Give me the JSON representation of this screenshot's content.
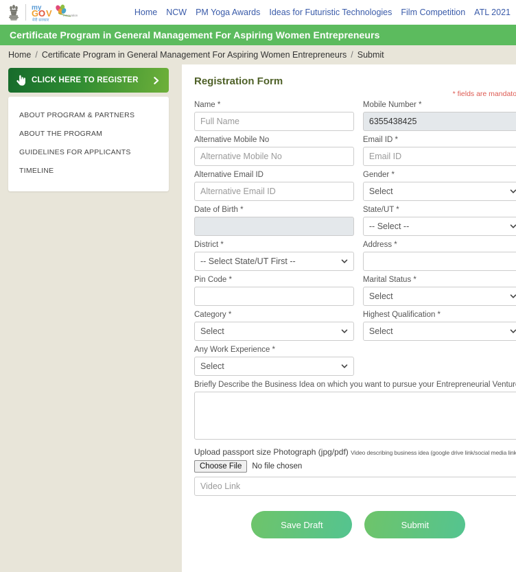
{
  "topnav": {
    "logo_alt": "myGov",
    "links": [
      {
        "label": "Home"
      },
      {
        "label": "NCW"
      },
      {
        "label": "PM Yoga Awards"
      },
      {
        "label": "Ideas for Futuristic Technologies"
      },
      {
        "label": "Film Competition"
      },
      {
        "label": "ATL 2021"
      }
    ]
  },
  "banner": {
    "title": "Certificate Program in General Management For Aspiring Women Entrepreneurs",
    "color": "#5cbb5e"
  },
  "breadcrumb": {
    "items": [
      {
        "label": "Home"
      },
      {
        "label": "Certificate Program in General Management For Aspiring Women Entrepreneurs"
      },
      {
        "label": "Submit"
      }
    ],
    "separator": "/"
  },
  "sidebar": {
    "register_button": {
      "label": "CLICK HERE TO REGISTER"
    },
    "items": [
      {
        "label": "ABOUT PROGRAM & PARTNERS"
      },
      {
        "label": "ABOUT THE PROGRAM"
      },
      {
        "label": "GUIDELINES FOR APPLICANTS"
      },
      {
        "label": "TIMELINE"
      }
    ]
  },
  "form": {
    "title": "Registration Form",
    "title_color": "#4f6128",
    "mandatory_note": "* fields are mandatory",
    "mandatory_color": "#dd5a52",
    "fields": {
      "name": {
        "label": "Name *",
        "placeholder": "Full Name",
        "value": ""
      },
      "mobile": {
        "label": "Mobile Number *",
        "placeholder": "",
        "value": "6355438425"
      },
      "alt_mobile": {
        "label": "Alternative Mobile No",
        "placeholder": "Alternative Mobile No",
        "value": ""
      },
      "email": {
        "label": "Email ID *",
        "placeholder": "Email ID",
        "value": ""
      },
      "alt_email": {
        "label": "Alternative Email ID",
        "placeholder": "Alternative Email ID",
        "value": ""
      },
      "gender": {
        "label": "Gender *",
        "selected": "Select"
      },
      "dob": {
        "label": "Date of Birth *",
        "placeholder": "",
        "value": ""
      },
      "state": {
        "label": "State/UT *",
        "selected": "-- Select --"
      },
      "district": {
        "label": "District *",
        "selected": "-- Select State/UT First --"
      },
      "address": {
        "label": "Address *",
        "placeholder": "",
        "value": ""
      },
      "pincode": {
        "label": "Pin Code *",
        "placeholder": "",
        "value": ""
      },
      "marital": {
        "label": "Marital Status *",
        "selected": "Select"
      },
      "category": {
        "label": "Category *",
        "selected": "Select"
      },
      "qualification": {
        "label": "Highest Qualification *",
        "selected": "Select"
      },
      "experience": {
        "label": "Any Work Experience *",
        "selected": "Select"
      },
      "business_idea": {
        "label": "Briefly Describe the Business Idea on which you want to pursue your Entrepreneurial Venture*",
        "value": ""
      },
      "upload": {
        "label_main": "Upload passport size Photograph (jpg/pdf)",
        "label_small": "Video describing business idea (google drive link/social media link) *",
        "choose_label": "Choose File",
        "no_file_text": "No file chosen"
      },
      "video_link": {
        "placeholder": "Video Link",
        "value": ""
      }
    },
    "buttons": {
      "save_draft": "Save Draft",
      "submit": "Submit"
    }
  }
}
